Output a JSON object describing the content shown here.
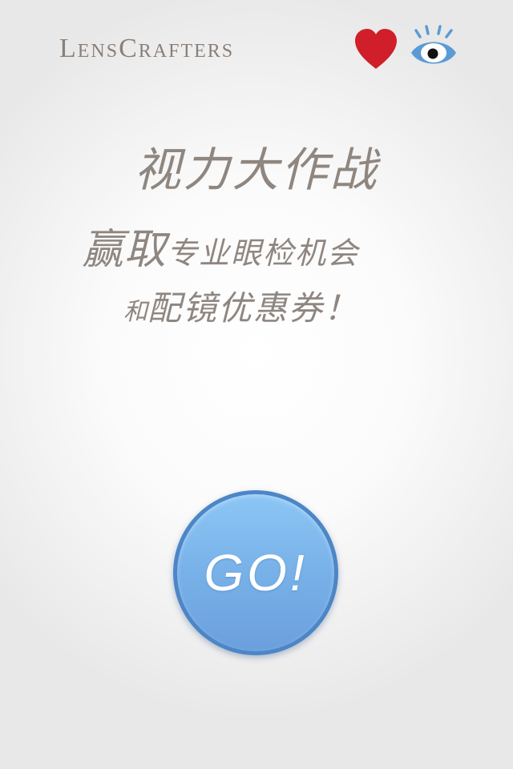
{
  "header": {
    "brand": "LensCrafters",
    "icons": {
      "heart": "heart-icon",
      "eye": "eye-icon"
    },
    "colors": {
      "brand_text": "#8a7f78",
      "heart": "#d01f2a",
      "eye": "#5b9bd5"
    }
  },
  "main": {
    "title": "视力大作战",
    "line2_big": "赢取",
    "line2_small": "专业眼检机会",
    "line3_small": "和",
    "line3_mid": "配镜优惠券！",
    "text_color": "#8f8680"
  },
  "action": {
    "go_label": "GO!",
    "button_color": "#78b1e8"
  }
}
